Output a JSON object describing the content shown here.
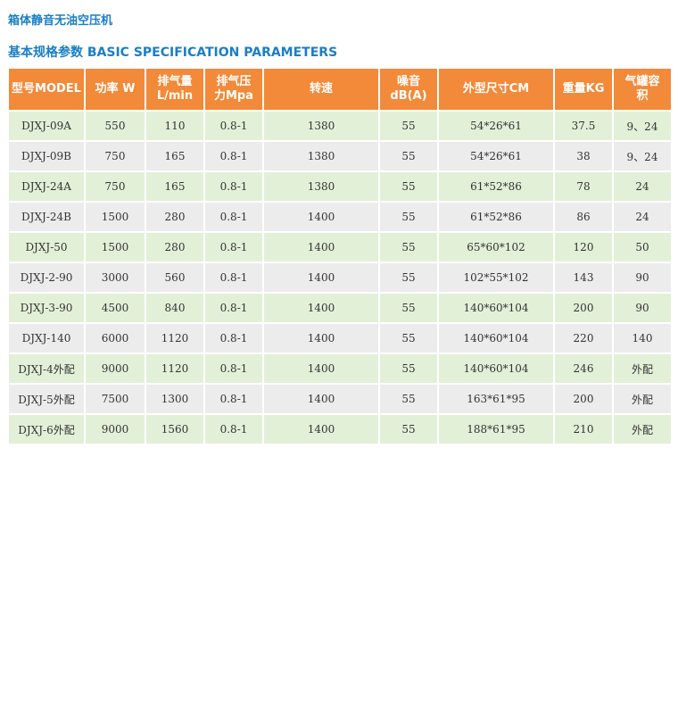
{
  "title": "箱体静音无油空压机",
  "section_title": "基本规格参数 BASIC SPECIFICATION PARAMETERS",
  "colors": {
    "accent_blue": "#1a7fc4",
    "header_orange": "#f28a3a",
    "row_green": "#e3f0d8",
    "row_gray": "#ececec"
  },
  "table": {
    "headers": [
      "型号MODEL",
      "功率 W",
      "排气量\nL/min",
      "排气压\n力Mpa",
      "转速",
      "噪音\ndB(A)",
      "外型尺寸CM",
      "重量KG",
      "气罐容\n积"
    ],
    "rows": [
      [
        "DJXJ-09A",
        "550",
        "110",
        "0.8-1",
        "1380",
        "55",
        "54*26*61",
        "37.5",
        "9、24"
      ],
      [
        "DJXJ-09B",
        "750",
        "165",
        "0.8-1",
        "1380",
        "55",
        "54*26*61",
        "38",
        "9、24"
      ],
      [
        "DJXJ-24A",
        "750",
        "165",
        "0.8-1",
        "1380",
        "55",
        "61*52*86",
        "78",
        "24"
      ],
      [
        "DJXJ-24B",
        "1500",
        "280",
        "0.8-1",
        "1400",
        "55",
        "61*52*86",
        "86",
        "24"
      ],
      [
        "DJXJ-50",
        "1500",
        "280",
        "0.8-1",
        "1400",
        "55",
        "65*60*102",
        "120",
        "50"
      ],
      [
        "DJXJ-2-90",
        "3000",
        "560",
        "0.8-1",
        "1400",
        "55",
        "102*55*102",
        "143",
        "90"
      ],
      [
        "DJXJ-3-90",
        "4500",
        "840",
        "0.8-1",
        "1400",
        "55",
        "140*60*104",
        "200",
        "90"
      ],
      [
        "DJXJ-140",
        "6000",
        "1120",
        "0.8-1",
        "1400",
        "55",
        "140*60*104",
        "220",
        "140"
      ],
      [
        "DJXJ-4外配",
        "9000",
        "1120",
        "0.8-1",
        "1400",
        "55",
        "140*60*104",
        "246",
        "外配"
      ],
      [
        "DJXJ-5外配",
        "7500",
        "1300",
        "0.8-1",
        "1400",
        "55",
        "163*61*95",
        "200",
        "外配"
      ],
      [
        "DJXJ-6外配",
        "9000",
        "1560",
        "0.8-1",
        "1400",
        "55",
        "188*61*95",
        "210",
        "外配"
      ]
    ]
  }
}
